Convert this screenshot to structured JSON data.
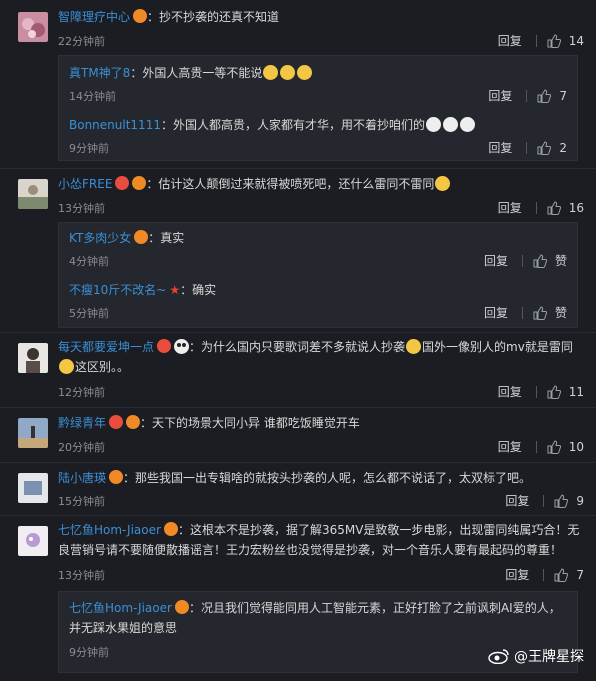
{
  "comments": [
    {
      "user": "智障理疗中心",
      "text": "：抄不抄袭的还真不知道",
      "time": "22分钟前",
      "reply": "回复",
      "likes": "14",
      "subs": [
        {
          "user": "真TM神了8",
          "text": "：外国人高贵一等不能说",
          "time": "14分钟前",
          "reply": "回复",
          "likes": "7"
        },
        {
          "user": "Bonnenult1111",
          "text": "：外国人都高贵，人家都有才华，用不着抄咱们的",
          "time": "9分钟前",
          "reply": "回复",
          "likes": "2"
        }
      ]
    },
    {
      "user": "小怂FREE",
      "text": "：估计这人颠倒过来就得被喷死吧，还什么雷同不雷同",
      "time": "13分钟前",
      "reply": "回复",
      "likes": "16",
      "subs": [
        {
          "user": "KT多肉少女",
          "text": "：真实",
          "time": "4分钟前",
          "reply": "回复",
          "likes": "赞"
        },
        {
          "user": "不瘦10斤不改名~",
          "text": "：确实",
          "time": "5分钟前",
          "reply": "回复",
          "likes": "赞"
        }
      ]
    },
    {
      "user": "每天都要爱坤一点",
      "text_a": "：为什么国内只要歌词差不多就说人抄袭",
      "text_b": "国外一像别人的mv就是雷同",
      "text_c": "这区别。。",
      "time": "12分钟前",
      "reply": "回复",
      "likes": "11"
    },
    {
      "user": "黔绿青年",
      "text": "：天下的场景大同小异 谁都吃饭睡觉开车",
      "time": "20分钟前",
      "reply": "回复",
      "likes": "10"
    },
    {
      "user": "陆小唐瑛",
      "text": "：那些我国一出专辑啥的就按头抄袭的人呢，怎么都不说话了，太双标了吧。",
      "time": "15分钟前",
      "reply": "回复",
      "likes": "9"
    },
    {
      "user": "七忆鱼Hom-Jiaoer",
      "text": "：这根本不是抄袭，据了解365MV是致敬一步电影，出现雷同纯属巧合！无良营销号请不要随便散播谣言！王力宏粉丝也没觉得是抄袭，对一个音乐人要有最起码的尊重！",
      "time": "13分钟前",
      "reply": "回复",
      "likes": "7",
      "subs": [
        {
          "user": "七忆鱼Hom-Jiaoer",
          "text": "：况且我们觉得能同用人工智能元素，正好打脸了之前讽刺AI爱的人，并无踩水果姐的意思",
          "time": "9分钟前"
        }
      ]
    }
  ],
  "watermark": "@王牌星探",
  "colors": {
    "username": "#3b8fd6",
    "background": "#1b1d22",
    "subbox": "#24272d"
  }
}
